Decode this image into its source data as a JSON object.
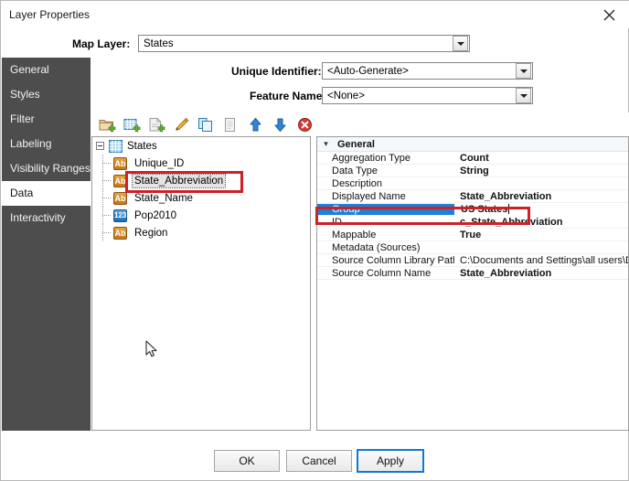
{
  "window": {
    "title": "Layer Properties",
    "close_icon": "close-icon"
  },
  "map_layer": {
    "label": "Map Layer:",
    "value": "States"
  },
  "sidebar": {
    "items": [
      {
        "label": "General",
        "selected": false
      },
      {
        "label": "Styles",
        "selected": false
      },
      {
        "label": "Filter",
        "selected": false
      },
      {
        "label": "Labeling",
        "selected": false
      },
      {
        "label": "Visibility Ranges",
        "selected": false
      },
      {
        "label": "Data",
        "selected": true
      },
      {
        "label": "Interactivity",
        "selected": false
      }
    ]
  },
  "form": {
    "unique_identifier": {
      "label": "Unique Identifier:",
      "value": "<Auto-Generate>"
    },
    "feature_name": {
      "label": "Feature Name:",
      "value": "<None>"
    }
  },
  "toolbar": {
    "buttons": [
      {
        "name": "add-folder-icon",
        "title": "Add Folder"
      },
      {
        "name": "add-table-icon",
        "title": "Add Table"
      },
      {
        "name": "add-column-icon",
        "title": "Add Column"
      },
      {
        "name": "edit-pencil-icon",
        "title": "Edit"
      },
      {
        "name": "copy-icon",
        "title": "Copy"
      },
      {
        "name": "paste-icon",
        "title": "Paste"
      },
      {
        "name": "move-up-icon",
        "title": "Move Up"
      },
      {
        "name": "move-down-icon",
        "title": "Move Down"
      },
      {
        "name": "delete-icon",
        "title": "Delete"
      }
    ]
  },
  "tree": {
    "root": {
      "label": "States",
      "icon": "table-icon",
      "expanded": true
    },
    "children": [
      {
        "label": "Unique_ID",
        "icon": "text-column-icon",
        "selected": false
      },
      {
        "label": "State_Abbreviation",
        "icon": "text-column-icon",
        "selected": true
      },
      {
        "label": "State_Name",
        "icon": "text-column-icon",
        "selected": false
      },
      {
        "label": "Pop2010",
        "icon": "number-column-icon",
        "selected": false
      },
      {
        "label": "Region",
        "icon": "text-column-icon",
        "selected": false
      }
    ]
  },
  "properties": {
    "category": "General",
    "rows": [
      {
        "name": "Aggregation Type",
        "value": "Count",
        "selected": false,
        "path": false
      },
      {
        "name": "Data Type",
        "value": "String",
        "selected": false,
        "path": false
      },
      {
        "name": "Description",
        "value": "",
        "selected": false,
        "path": false
      },
      {
        "name": "Displayed Name",
        "value": "State_Abbreviation",
        "selected": false,
        "path": false
      },
      {
        "name": "Group",
        "value": "US States",
        "selected": true,
        "path": false
      },
      {
        "name": "ID",
        "value": "c_State_Abbreviation",
        "selected": false,
        "path": false
      },
      {
        "name": "Mappable",
        "value": "True",
        "selected": false,
        "path": false
      },
      {
        "name": "Metadata (Sources)",
        "value": "",
        "selected": false,
        "path": false
      },
      {
        "name": "Source Column Library Path",
        "value": "C:\\Documents and Settings\\all users\\D",
        "selected": false,
        "path": true
      },
      {
        "name": "Source Column Name",
        "value": "State_Abbreviation",
        "selected": false,
        "path": false
      }
    ]
  },
  "footer": {
    "ok": "OK",
    "cancel": "Cancel",
    "apply": "Apply"
  },
  "colors": {
    "sidebar_bg": "#4d4d4d",
    "selection_blue": "#1f7fd4",
    "annotation_red": "#cf2027",
    "focus_blue": "#0f7ad6"
  }
}
